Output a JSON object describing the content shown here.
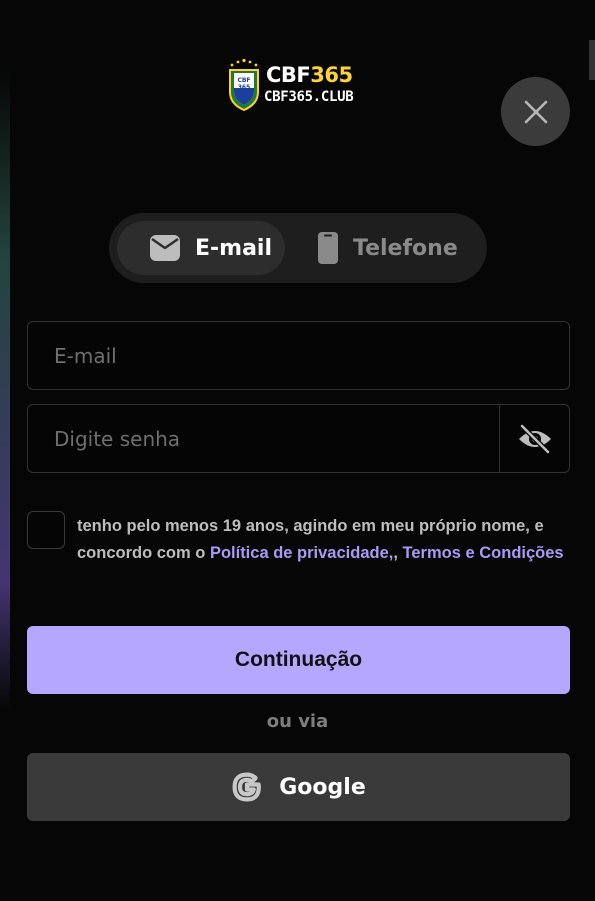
{
  "logo": {
    "brand_text": "CBF",
    "brand_number": "365",
    "domain": "CBF365.CLUB",
    "badge_text": "CBF 365"
  },
  "tabs": [
    {
      "label": "E-mail",
      "icon": "envelope-icon",
      "active": true
    },
    {
      "label": "Telefone",
      "icon": "phone-icon",
      "active": false
    }
  ],
  "form": {
    "email_placeholder": "E-mail",
    "email_value": "",
    "password_placeholder": "Digite senha",
    "password_value": ""
  },
  "terms": {
    "prefix": "tenho pelo menos 19 anos, agindo em meu próprio nome, e concordo com o ",
    "privacy_link": "Política de privacidade,",
    "separator": ", ",
    "terms_link": "Termos e Condições",
    "checked": false
  },
  "buttons": {
    "continue_label": "Continuação",
    "or_via": "ou via",
    "google_label": "Google"
  },
  "colors": {
    "accent": "#b5a6ff",
    "link": "#a99bf5",
    "background": "#060606",
    "gold": "#ffd22e"
  }
}
